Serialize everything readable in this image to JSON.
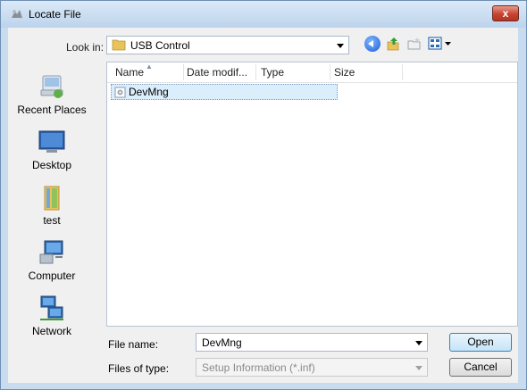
{
  "window": {
    "title": "Locate File",
    "close_label": "x"
  },
  "toolbar": {
    "lookin_label": "Look in:",
    "lookin_value": "USB Control"
  },
  "places": [
    {
      "label": "Recent Places"
    },
    {
      "label": "Desktop"
    },
    {
      "label": "test"
    },
    {
      "label": "Computer"
    },
    {
      "label": "Network"
    }
  ],
  "filelist": {
    "columns": [
      "Name",
      "Date modif...",
      "Type",
      "Size"
    ],
    "rows": [
      {
        "name": "DevMng"
      }
    ]
  },
  "footer": {
    "filename_label": "File name:",
    "filename_value": "DevMng",
    "filetype_label": "Files of type:",
    "filetype_value": "Setup Information (*.inf)",
    "open_label": "Open",
    "cancel_label": "Cancel"
  },
  "colors": {
    "titlebar": "#bcd3ec",
    "selection": "#dbeefc",
    "close": "#c64330"
  }
}
